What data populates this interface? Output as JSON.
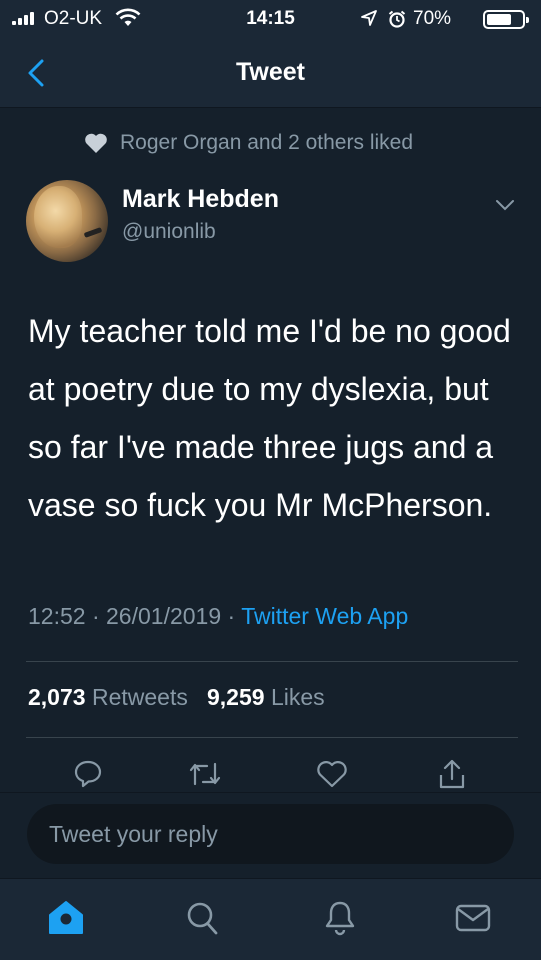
{
  "status_bar": {
    "carrier": "O2-UK",
    "time": "14:15",
    "battery_percent": "70%",
    "battery_level": 0.7
  },
  "nav": {
    "title": "Tweet",
    "back_icon": "chevron-left-icon"
  },
  "social_context": {
    "icon": "heart-icon",
    "text": "Roger Organ and 2 others liked"
  },
  "author": {
    "name": "Mark Hebden",
    "handle": "@unionlib"
  },
  "tweet": {
    "text": "My teacher told me I'd be no good at poetry due to my dyslexia, but so far I've made three jugs and a vase so fuck you Mr McPherson.",
    "time": "12:52",
    "date": "26/01/2019",
    "separator": "·",
    "source": "Twitter Web App"
  },
  "stats": {
    "retweets_count": "2,073",
    "retweets_label": "Retweets",
    "likes_count": "9,259",
    "likes_label": "Likes"
  },
  "actions": [
    "reply-icon",
    "retweet-icon",
    "like-icon",
    "share-icon"
  ],
  "reply": {
    "placeholder": "Tweet your reply"
  },
  "tabs": [
    "home-icon",
    "search-icon",
    "notifications-icon",
    "messages-icon"
  ],
  "colors": {
    "background": "#15202b",
    "bars": "#1b2836",
    "accent": "#1da1f2",
    "secondary_text": "#8899a6"
  }
}
